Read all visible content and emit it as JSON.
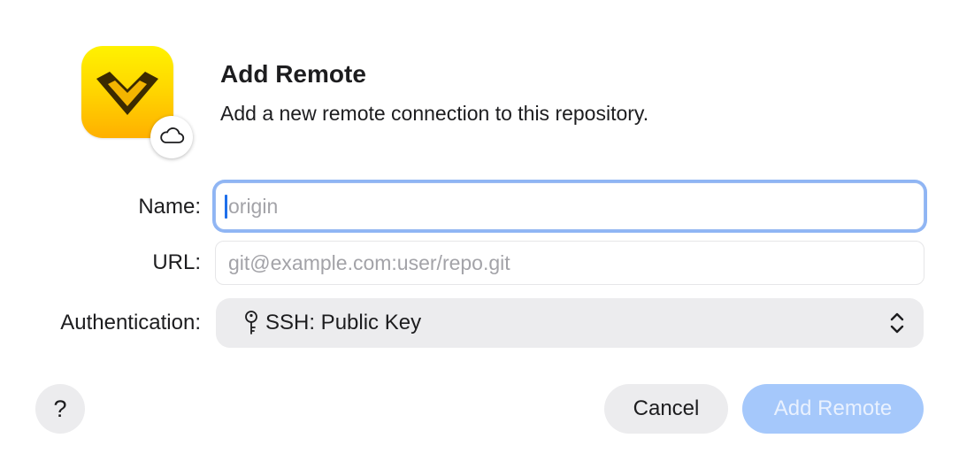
{
  "header": {
    "title": "Add Remote",
    "subtitle": "Add a new remote connection to this repository.",
    "app_icon": "app-chevron-logo",
    "badge_icon": "cloud-icon"
  },
  "form": {
    "name": {
      "label": "Name:",
      "value": "",
      "placeholder": "origin",
      "focused": true
    },
    "url": {
      "label": "URL:",
      "value": "",
      "placeholder": "git@example.com:user/repo.git"
    },
    "authentication": {
      "label": "Authentication:",
      "selected": "SSH: Public Key",
      "icon": "key-icon"
    }
  },
  "footer": {
    "help_label": "?",
    "cancel_label": "Cancel",
    "submit_label": "Add Remote",
    "submit_enabled": false
  },
  "colors": {
    "icon_yellow": "#ffd800",
    "focus_ring": "#8fb5f4",
    "primary_disabled": "#a5c8fb",
    "control_bg": "#ececee"
  }
}
